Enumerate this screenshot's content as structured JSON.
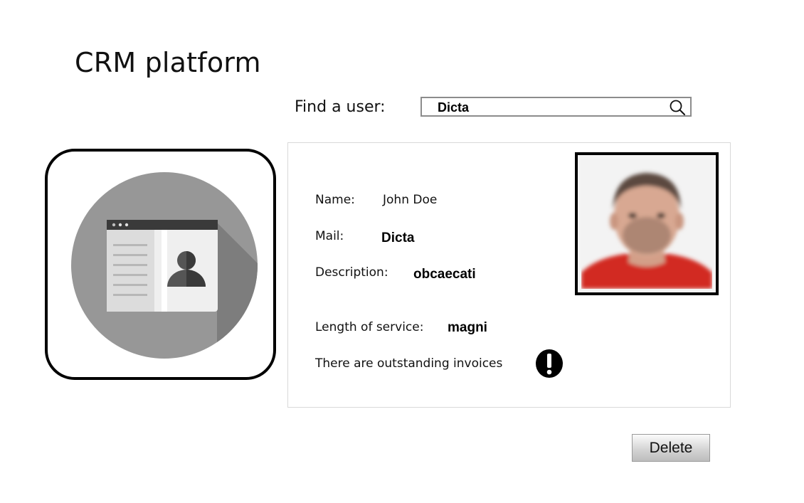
{
  "app": {
    "title": "CRM platform"
  },
  "search": {
    "label": "Find a user:",
    "value": "Dicta",
    "icon": "search-icon"
  },
  "profile": {
    "name_label": "Name:",
    "name_value": "John Doe",
    "mail_label": "Mail:",
    "mail_value": "Dicta",
    "description_label": "Description:",
    "description_value": "obcaecati",
    "service_label": "Length of service:",
    "service_value": "magni",
    "invoice_notice": "There are outstanding invoices",
    "warning_icon": "exclamation-icon",
    "photo": "user-photo"
  },
  "actions": {
    "delete_label": "Delete"
  },
  "colors": {
    "icon_circle": "#979797",
    "icon_shadow": "#7d7d7d",
    "card_bar": "#3a3a3a",
    "card_body": "#e6e6e6"
  }
}
